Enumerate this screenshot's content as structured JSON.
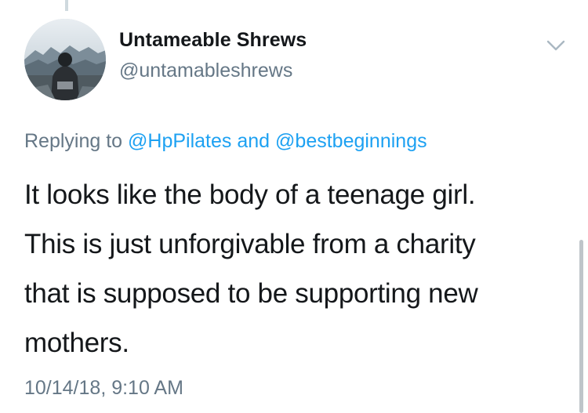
{
  "tweet": {
    "display_name": "Untameable Shrews",
    "handle": "@untamableshrews",
    "replying": {
      "prefix": "Replying to",
      "mention_1": "@HpPilates",
      "connector": "and",
      "mention_2": "@bestbeginnings"
    },
    "text_lines": [
      "It looks like the body of a teenage girl.",
      "This is just unforgivable from a charity",
      "that is supposed to be supporting new",
      "mothers."
    ],
    "timestamp": "10/14/18, 9:10 AM"
  },
  "colors": {
    "link": "#1da1f2",
    "secondary_text": "#657786",
    "primary_text": "#14171a"
  },
  "icons": {
    "caret": "chevron-down-icon",
    "avatar": "avatar"
  }
}
